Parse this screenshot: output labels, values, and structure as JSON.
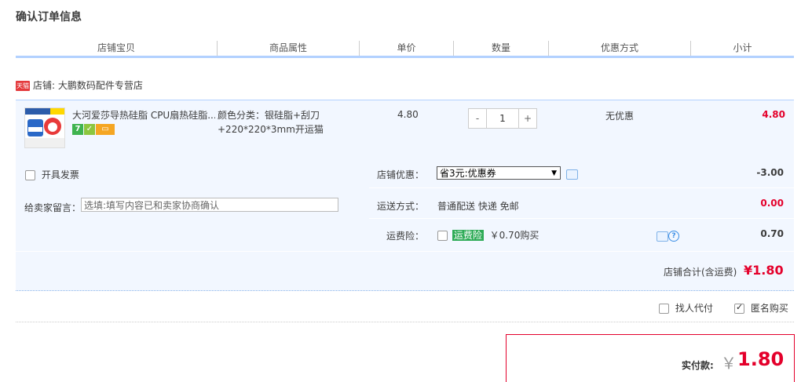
{
  "page_title": "确认订单信息",
  "columns": [
    "店铺宝贝",
    "商品属性",
    "单价",
    "数量",
    "优惠方式",
    "小计"
  ],
  "shop": {
    "badge": "天猫",
    "label": "店铺: 大鹏数码配件专营店"
  },
  "item": {
    "name": "大河爱莎导热硅脂 CPU扇热硅脂...",
    "property": "颜色分类：银硅脂+刮刀+220*220*3mm开运猫",
    "unit_price": "4.80",
    "quantity": "1",
    "qty_minus": "-",
    "qty_plus": "+",
    "discount": "无优惠",
    "subtotal": "4.80",
    "icon_names": [
      "7day-return-icon",
      "seller-guarantee-icon",
      "credit-card-icon"
    ]
  },
  "options": {
    "invoice_label": "开具发票",
    "memo_label": "给卖家留言：",
    "memo_placeholder": "选填:填写内容已和卖家协商确认",
    "coupon_label": "店铺优惠：",
    "coupon_selected": "省3元:优惠券",
    "coupon_amount": "-3.00",
    "shipping_label": "运送方式：",
    "shipping_value": "普通配送 快递 免邮",
    "shipping_amount": "0.00",
    "insurance_label": "运费险：",
    "insurance_tag": "运费险",
    "insurance_price": "￥0.70购买",
    "insurance_amount": "0.70"
  },
  "shop_total": {
    "label": "店铺合计(含运费)",
    "value": "¥1.80"
  },
  "footer": {
    "proxy_pay_label": "找人代付",
    "anonymous_label": "匿名购买",
    "anonymous_checked": true,
    "pay_label": "实付款:",
    "pay_currency": "￥",
    "pay_value": "1.80"
  },
  "colors": {
    "accent_red": "#e4002b",
    "header_line": "#b2d1ff",
    "row_bg": "#f2f7ff",
    "insurance_green": "#2eab57"
  }
}
